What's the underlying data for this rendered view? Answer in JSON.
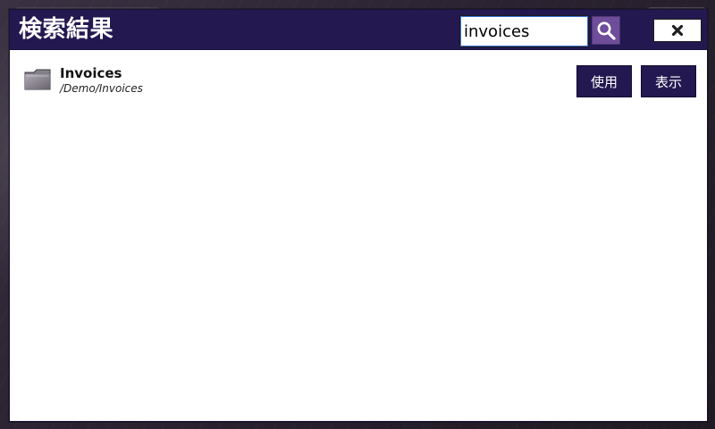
{
  "dialog": {
    "title": "検索結果",
    "search": {
      "value": "invoices"
    },
    "buttons": {
      "search_icon": "search-icon",
      "close_icon": "close-icon"
    }
  },
  "results": [
    {
      "icon": "folder-icon",
      "title": "Invoices",
      "path": "/Demo/Invoices",
      "actions": {
        "use_label": "使用",
        "view_label": "表示"
      }
    }
  ],
  "colors": {
    "header_bg": "#231850",
    "button_bg": "#231850",
    "search_button_bg": "#6e4d9a"
  }
}
